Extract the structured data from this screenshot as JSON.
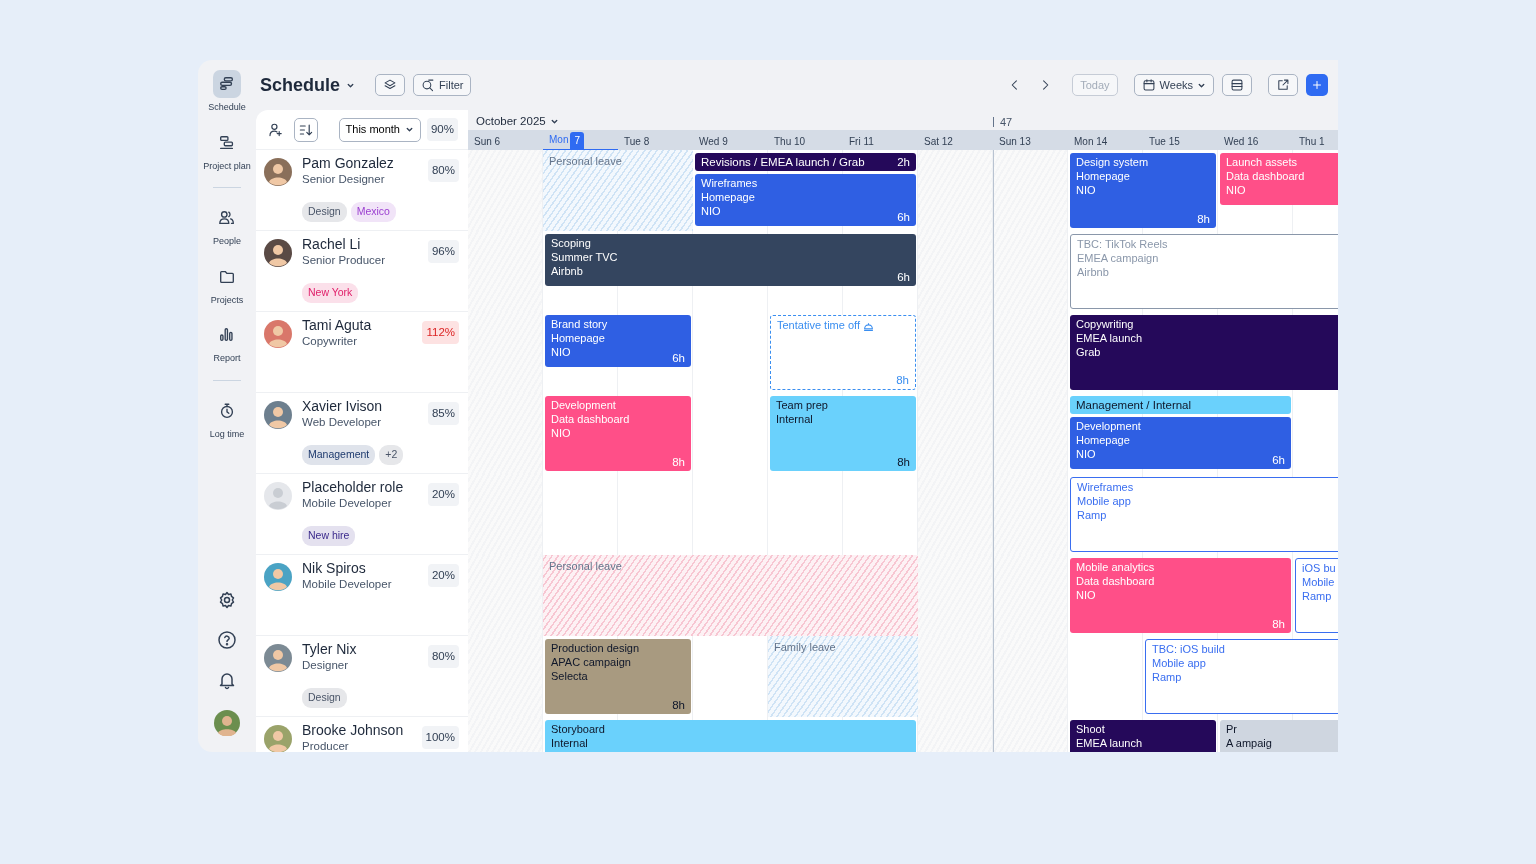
{
  "sidebar": {
    "groups": [
      [
        {
          "label": "Schedule",
          "selected": true
        },
        {
          "label": "Project plan",
          "selected": false
        }
      ],
      [
        {
          "label": "People",
          "selected": false
        },
        {
          "label": "Projects",
          "selected": false
        },
        {
          "label": "Report",
          "selected": false
        }
      ],
      [
        {
          "label": "Log time",
          "selected": false
        }
      ]
    ]
  },
  "toolbar": {
    "title": "Schedule",
    "filter": "Filter",
    "today": "Today",
    "today_disabled": true,
    "view": "Weeks"
  },
  "people_header": {
    "period": "This month",
    "utilization": "90%"
  },
  "timeline": {
    "month": "October 2025",
    "days": [
      {
        "label": "Sun 6",
        "weekend": true,
        "selected": false
      },
      {
        "label": "Mon",
        "date": "7",
        "weekend": false,
        "selected": true
      },
      {
        "label": "Tue 8",
        "weekend": false,
        "selected": false
      },
      {
        "label": "Wed 9",
        "weekend": false,
        "selected": false
      },
      {
        "label": "Thu 10",
        "weekend": false,
        "selected": false
      },
      {
        "label": "Fri 11",
        "weekend": false,
        "selected": false
      },
      {
        "label": "Sat 12",
        "weekend": true,
        "selected": false
      },
      {
        "label": "Sun 13",
        "weekend": true,
        "selected": false,
        "week_label": "47"
      },
      {
        "label": "Mon 14",
        "weekend": false,
        "selected": false
      },
      {
        "label": "Tue 15",
        "weekend": false,
        "selected": false
      },
      {
        "label": "Wed 16",
        "weekend": false,
        "selected": false
      },
      {
        "label": "Thu 1",
        "weekend": false,
        "selected": false
      }
    ]
  },
  "people": [
    {
      "name": "Pam Gonzalez",
      "role": "Senior Designer",
      "utilization": "80%",
      "over": false,
      "placeholder": false,
      "tags": [
        {
          "label": "Design",
          "color": "#4a5568"
        },
        {
          "label": "Mexico",
          "color": "#9b3fd0"
        }
      ],
      "leaves": [
        {
          "label": "Personal leave",
          "color": "#cfe3f5"
        }
      ],
      "events": [
        {
          "kind": "bar",
          "lines": [
            "Revisions / EMEA launch / Grab"
          ],
          "hours": "2h",
          "color": "#25095a"
        },
        {
          "kind": "block",
          "lines": [
            "Wireframes",
            "Homepage",
            "NIO"
          ],
          "hours": "6h",
          "color": "#2f5fe3",
          "tall": false
        },
        {
          "kind": "block",
          "lines": [
            "Design system",
            "Homepage",
            "NIO"
          ],
          "hours": "8h",
          "color": "#2f5fe3",
          "tall": true
        },
        {
          "kind": "block",
          "lines": [
            "Launch assets",
            "Data dashboard",
            "NIO"
          ],
          "color": "#ff4f88",
          "tall": false
        }
      ]
    },
    {
      "name": "Rachel Li",
      "role": "Senior Producer",
      "utilization": "96%",
      "over": false,
      "placeholder": false,
      "tags": [
        {
          "label": "New York",
          "color": "#e0206a"
        }
      ],
      "events": [
        {
          "kind": "block",
          "lines": [
            "Scoping",
            "Summer TVC",
            "Airbnb"
          ],
          "hours": "6h",
          "color": "#34455f",
          "tall": false
        },
        {
          "kind": "outline",
          "lines": [
            "TBC: TikTok Reels",
            "EMEA campaign",
            "Airbnb"
          ],
          "color": "#8a97aa",
          "tall": true
        }
      ]
    },
    {
      "name": "Tami Aguta",
      "role": "Copywriter",
      "utilization": "112%",
      "over": true,
      "placeholder": false,
      "events": [
        {
          "kind": "block",
          "lines": [
            "Brand story",
            "Homepage",
            "NIO"
          ],
          "hours": "6h",
          "color": "#2f5fe3",
          "tall": false
        },
        {
          "kind": "tentative",
          "lines": [
            "Tentative time off"
          ],
          "hours": "8h",
          "color": "#3a8ef0",
          "tall": true
        },
        {
          "kind": "block",
          "lines": [
            "Copywriting",
            "EMEA launch",
            "Grab"
          ],
          "color": "#25095a",
          "tall": true
        }
      ]
    },
    {
      "name": "Xavier Ivison",
      "role": "Web Developer",
      "utilization": "85%",
      "over": false,
      "placeholder": false,
      "tags": [
        {
          "label": "Management",
          "color": "#1e3a6e"
        },
        {
          "label": "+2",
          "color": "#4a5568"
        }
      ],
      "events": [
        {
          "kind": "block",
          "lines": [
            "Development",
            "Data dashboard",
            "NIO"
          ],
          "hours": "8h",
          "color": "#ff4f88",
          "tall": true
        },
        {
          "kind": "block",
          "lines": [
            "Team prep",
            "Internal"
          ],
          "hours": "8h",
          "color": "#6ad1fc",
          "tall": true
        },
        {
          "kind": "bar",
          "lines": [
            "Management / Internal"
          ],
          "color": "#6ad1fc"
        },
        {
          "kind": "block",
          "lines": [
            "Development",
            "Homepage",
            "NIO"
          ],
          "hours": "6h",
          "color": "#2f5fe3",
          "tall": false
        }
      ]
    },
    {
      "name": "Placeholder role",
      "role": "Mobile Developer",
      "utilization": "20%",
      "over": false,
      "placeholder": true,
      "tags": [
        {
          "label": "New hire",
          "color": "#3b2a8c"
        }
      ],
      "events": [
        {
          "kind": "outline",
          "lines": [
            "Wireframes",
            "Mobile app",
            "Ramp"
          ],
          "color": "#3a6ef0",
          "tall": true
        }
      ]
    },
    {
      "name": "Nik Spiros",
      "role": "Mobile Developer",
      "utilization": "20%",
      "over": false,
      "placeholder": false,
      "leaves": [
        {
          "label": "Personal leave",
          "color": "#f7c6d2"
        }
      ],
      "events": [
        {
          "kind": "block",
          "lines": [
            "Mobile analytics",
            "Data dashboard",
            "NIO"
          ],
          "hours": "8h",
          "color": "#ff4f88",
          "tall": true
        },
        {
          "kind": "outline",
          "lines": [
            "iOS bu",
            "Mobile",
            "Ramp"
          ],
          "color": "#3a6ef0",
          "tall": true
        }
      ]
    },
    {
      "name": "Tyler Nix",
      "role": "Designer",
      "utilization": "80%",
      "over": false,
      "placeholder": false,
      "tags": [
        {
          "label": "Design",
          "color": "#4a5568"
        }
      ],
      "leaves": [
        {
          "label": "Family leave",
          "color": "#cfe3f5"
        }
      ],
      "events": [
        {
          "kind": "block",
          "lines": [
            "Production design",
            "APAC campaign",
            "Selecta"
          ],
          "hours": "8h",
          "color": "#a89a80",
          "tall": true
        },
        {
          "kind": "outline",
          "lines": [
            "TBC: iOS build",
            "Mobile app",
            "Ramp"
          ],
          "color": "#3a6ef0",
          "tall": true
        }
      ]
    },
    {
      "name": "Brooke Johnson",
      "role": "Producer",
      "utilization": "100%",
      "over": false,
      "placeholder": false,
      "events": [
        {
          "kind": "block",
          "lines": [
            "Storyboard",
            "Internal"
          ],
          "color": "#6ad1fc",
          "tall": true
        },
        {
          "kind": "block",
          "lines": [
            "Shoot",
            "EMEA launch"
          ],
          "color": "#25095a",
          "tall": true
        },
        {
          "kind": "block",
          "lines": [
            "Pr",
            "A ampaig"
          ],
          "color": "#cfd6e0",
          "tall": true
        }
      ]
    }
  ]
}
